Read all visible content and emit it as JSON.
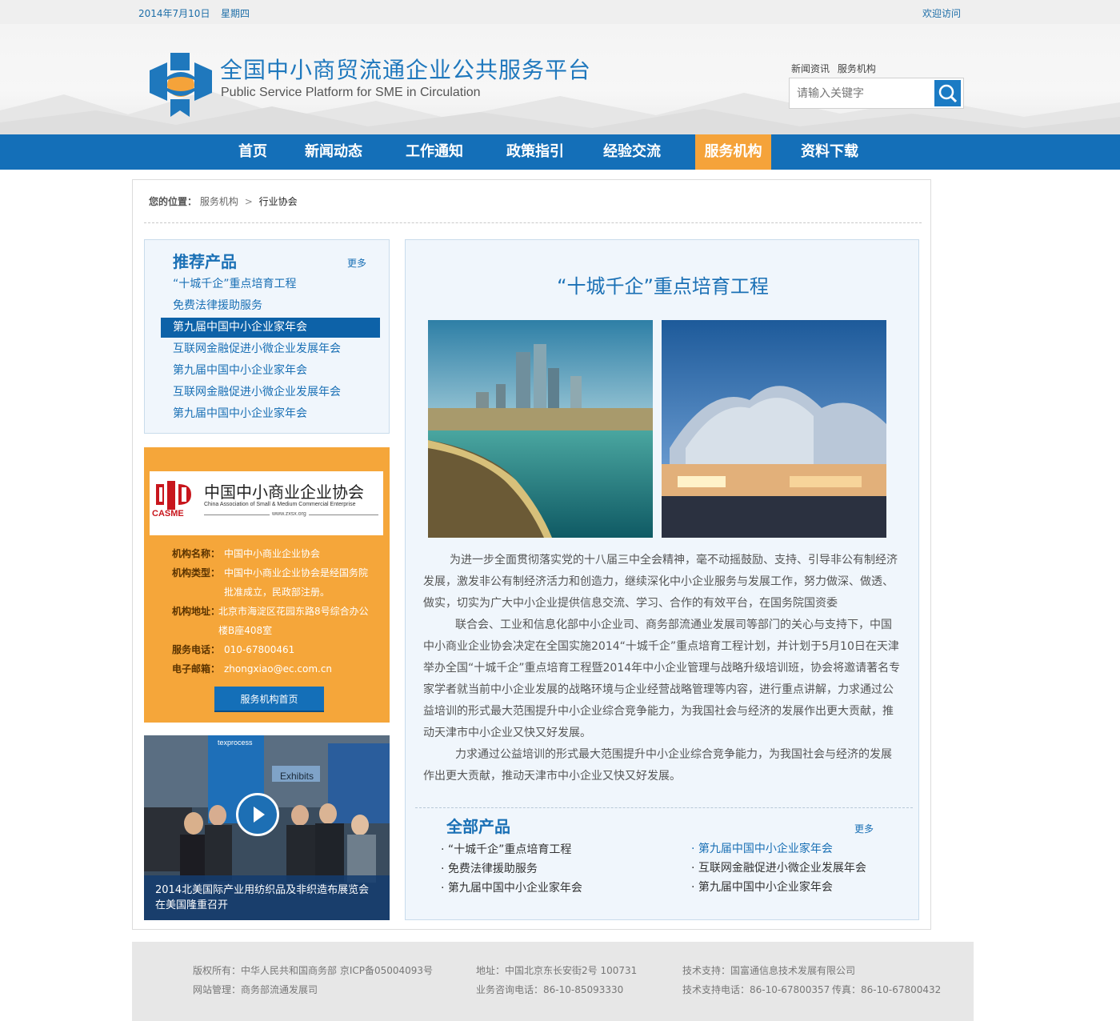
{
  "topbar": {
    "date": "2014年7月10日",
    "weekday": "星期四",
    "welcome": "欢迎访问"
  },
  "header": {
    "title": "全国中小商贸流通企业公共服务平台",
    "subtitle": "Public Service Platform for SME in Circulation",
    "quicklinks": [
      "新闻资讯",
      "服务机构"
    ],
    "search_placeholder": "请输入关键字"
  },
  "nav": {
    "items": [
      "首页",
      "新闻动态",
      "工作通知",
      "政策指引",
      "经验交流",
      "服务机构",
      "资料下载"
    ],
    "active": "服务机构"
  },
  "breadcrumb": {
    "label": "您的位置：",
    "parent": "服务机构",
    "separator": ">",
    "current": "行业协会"
  },
  "recommended": {
    "title": "推荐产品",
    "more": "更多",
    "items": [
      "“十城千企”重点培育工程",
      "免费法律援助服务",
      "第九届中国中小企业家年会",
      "互联网金融促进小微企业发展年会",
      "第九届中国中小企业家年会",
      "互联网金融促进小微企业发展年会",
      "第九届中国中小企业家年会"
    ],
    "selected_index": 2
  },
  "org": {
    "logo_cn": "中国中小商业企业协会",
    "logo_en": "China Association of Small & Medium Commercial Enterprise",
    "logo_abbr": "CASME",
    "logo_url": "www.zxsx.org",
    "name_label": "机构名称：",
    "name": "中国中小商业企业协会",
    "type_label": "机构类型：",
    "type": "中国中小商业企业协会是经国务院批准成立，民政部注册。",
    "addr_label": "机构地址：",
    "addr": "北京市海淀区花园东路8号综合办公楼B座408室",
    "phone_label": "服务电话：",
    "phone": "010-67800461",
    "email_label": "电子邮箱：",
    "email": "zhongxiao@ec.com.cn",
    "button": "服务机构首页"
  },
  "video": {
    "caption": "2014北美国际产业用纺织品及非织造布展览会在美国隆重召开",
    "sign1": "Exhibits",
    "sign2": "texprocess"
  },
  "article": {
    "title": "“十城千企”重点培育工程",
    "p1": "为进一步全面贯彻落实党的十八届三中全会精神，毫不动摇鼓励、支持、引导非公有制经济发展，激发非公有制经济活力和创造力，继续深化中小企业服务与发展工作，努力做深、做透、做实，切实为广大中小企业提供信息交流、学习、合作的有效平台，在国务院国资委",
    "p2": "联合会、工业和信息化部中小企业司、商务部流通业发展司等部门的关心与支持下，中国中小商业企业协会决定在全国实施2014“十城千企”重点培育工程计划，并计划于5月10日在天津举办全国“十城千企”重点培育工程暨2014年中小企业管理与战略升级培训班，协会将邀请著名专家学者就当前中小企业发展的战略环境与企业经营战略管理等内容，进行重点讲解，力求通过公益培训的形式最大范围提升中小企业综合竞争能力，为我国社会与经济的发展作出更大贡献，推动天津市中小企业又快又好发展。",
    "p3": "力求通过公益培训的形式最大范围提升中小企业综合竞争能力，为我国社会与经济的发展作出更大贡献，推动天津市中小企业又快又好发展。"
  },
  "all_products": {
    "title": "全部产品",
    "more": "更多",
    "left": [
      "“十城千企”重点培育工程",
      "免费法律援助服务",
      "第九届中国中小企业家年会"
    ],
    "right": [
      "第九届中国中小企业家年会",
      "互联网金融促进小微企业发展年会",
      "第九届中国中小企业家年会"
    ],
    "bullet": "·"
  },
  "footer": {
    "copyright": "版权所有：中华人民共和国商务部  京ICP备05004093号",
    "manage": "网站管理：商务部流通发展司",
    "address": "地址：中国北京东长安街2号  100731",
    "consult": "业务咨询电话：86-10-85093330",
    "support": "技术支持：国富通信息技术发展有限公司",
    "support_phone": "技术支持电话：86-10-67800357",
    "fax": "传真：86-10-67800432"
  },
  "colors": {
    "brand_blue": "#146fb8",
    "accent_orange": "#f5a33a",
    "panel_bg": "#f0f6fc"
  }
}
